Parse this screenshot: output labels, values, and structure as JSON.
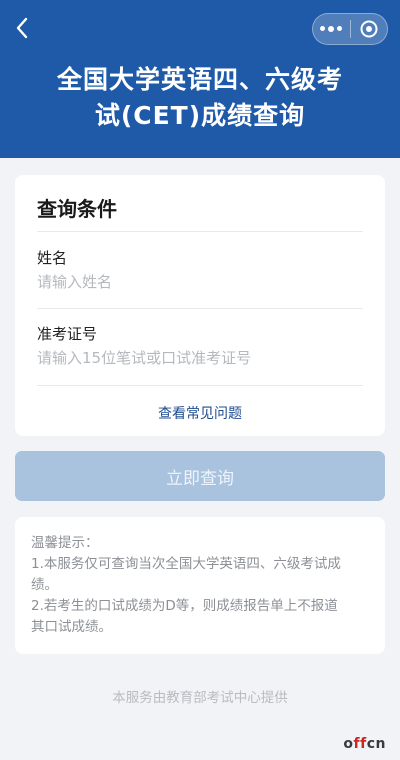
{
  "header": {
    "title_line1": "全国大学英语四、六级考",
    "title_line2": "试(CET)成绩查询",
    "background_color": "#1f5aa8",
    "icons": [
      "chevron-left-icon",
      "more-dots-icon",
      "target-circle-icon"
    ]
  },
  "form": {
    "section_title": "查询条件",
    "name_label": "姓名",
    "name_placeholder": "请输入姓名",
    "ticket_label": "准考证号",
    "ticket_placeholder": "请输入15位笔试或口试准考证号",
    "faq_link": "查看常见问题",
    "submit_label": "立即查询",
    "submit_color": "#a9c2de"
  },
  "tips": {
    "heading": "温馨提示：",
    "line1": "1.本服务仅可查询当次全国大学英语四、六级考试成",
    "line1b": "绩。",
    "line2": "2.若考生的口试成绩为D等，则成绩报告单上不报道",
    "line2b": "其口试成绩。"
  },
  "footer": {
    "provider_text": "本服务由教育部考试中心提供"
  },
  "watermark": {
    "prefix": "o",
    "accent": "ff",
    "suffix": "cn"
  }
}
